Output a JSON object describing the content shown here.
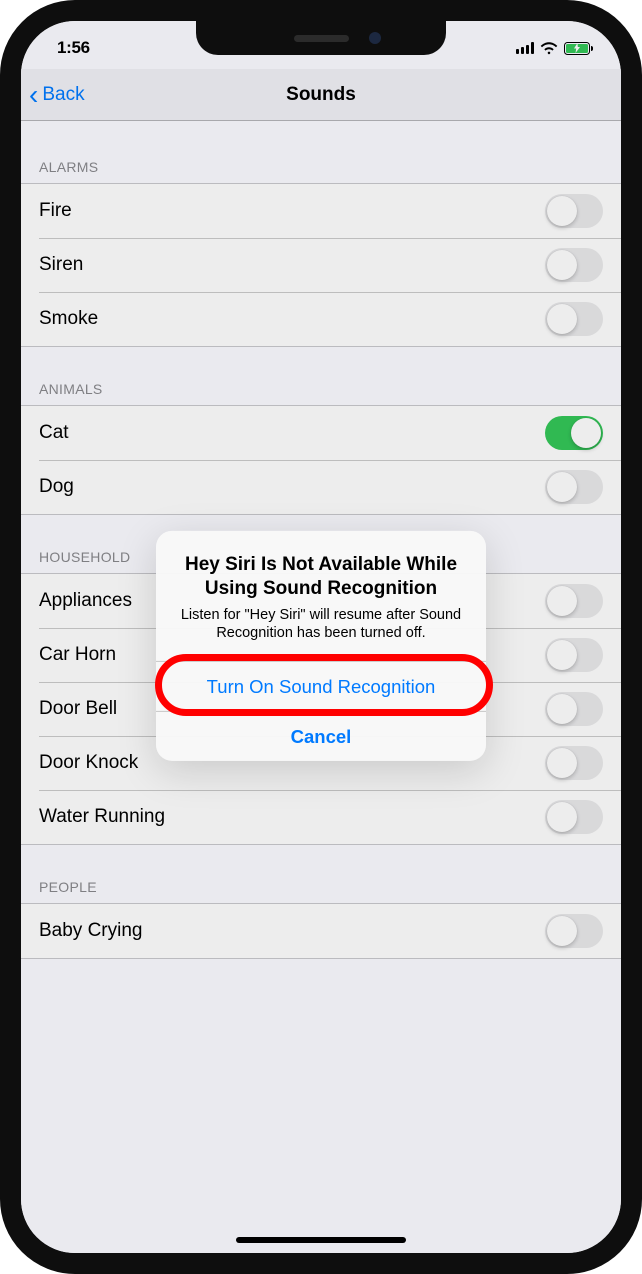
{
  "status": {
    "time": "1:56"
  },
  "nav": {
    "back_label": "Back",
    "title": "Sounds"
  },
  "sections": {
    "alarms": {
      "header": "ALARMS",
      "items": [
        {
          "label": "Fire",
          "on": false
        },
        {
          "label": "Siren",
          "on": false
        },
        {
          "label": "Smoke",
          "on": false
        }
      ]
    },
    "animals": {
      "header": "ANIMALS",
      "items": [
        {
          "label": "Cat",
          "on": true
        },
        {
          "label": "Dog",
          "on": false
        }
      ]
    },
    "household": {
      "header": "HOUSEHOLD",
      "items": [
        {
          "label": "Appliances",
          "on": false
        },
        {
          "label": "Car Horn",
          "on": false
        },
        {
          "label": "Door Bell",
          "on": false
        },
        {
          "label": "Door Knock",
          "on": false
        },
        {
          "label": "Water Running",
          "on": false
        }
      ]
    },
    "people": {
      "header": "PEOPLE",
      "items": [
        {
          "label": "Baby Crying",
          "on": false
        }
      ]
    }
  },
  "alert": {
    "title": "Hey Siri Is Not Available While Using Sound Recognition",
    "message": "Listen for \"Hey Siri\" will resume after Sound Recognition has been turned off.",
    "primary": "Turn On Sound Recognition",
    "cancel": "Cancel"
  }
}
